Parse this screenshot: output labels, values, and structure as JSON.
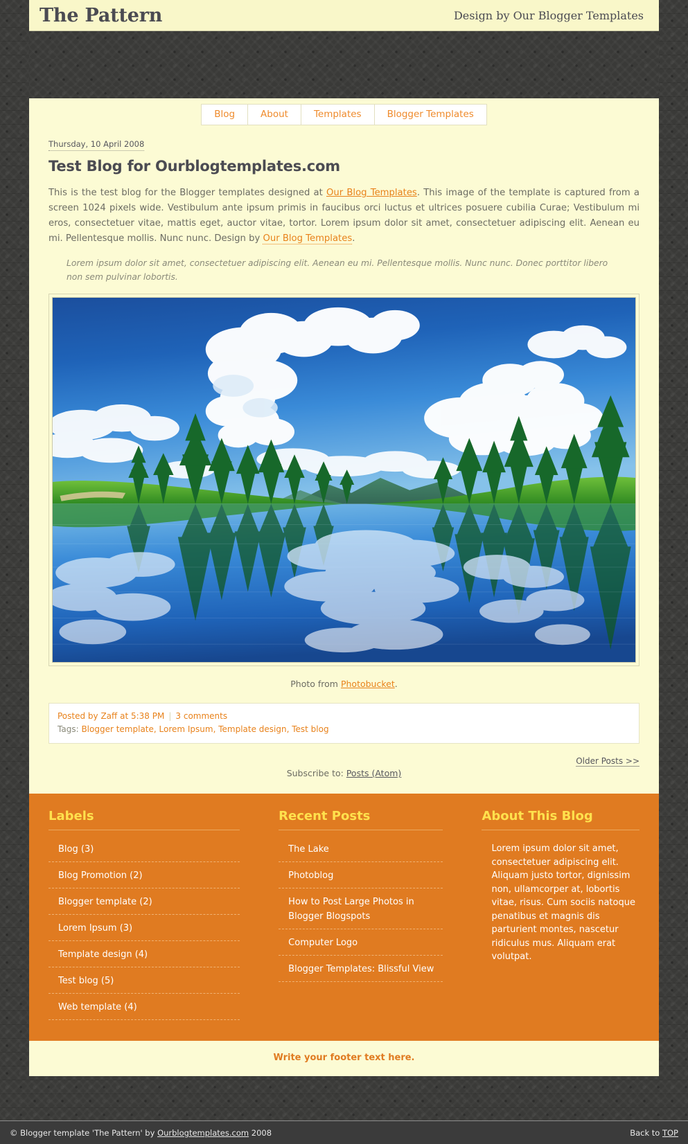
{
  "header": {
    "blog_title": "The Pattern",
    "designer_credit": "Design by Our Blogger Templates"
  },
  "nav": {
    "items": [
      {
        "label": "Blog"
      },
      {
        "label": "About"
      },
      {
        "label": "Templates"
      },
      {
        "label": "Blogger Templates"
      }
    ]
  },
  "post": {
    "date": "Thursday, 10 April 2008",
    "title": "Test Blog for Ourblogtemplates.com",
    "body_part1": "This is the test blog for the Blogger templates designed at ",
    "link1": "Our Blog Templates",
    "body_part2": ". This image of the template is captured from a screen 1024 pixels wide. Vestibulum ante ipsum primis in faucibus orci luctus et ultrices posuere cubilia Curae; Vestibulum mi eros, consectetuer vitae, mattis eget, auctor vitae, tortor. Lorem ipsum dolor sit amet, consectetuer adipiscing elit. Aenean eu mi. Pellentesque mollis. Nunc nunc. Design by ",
    "link2": "Our Blog Templates",
    "body_part3": ".",
    "quote": "Lorem ipsum dolor sit amet, consectetuer adipiscing elit. Aenean eu mi. Pellentesque mollis. Nunc nunc. Donec porttitor libero non sem pulvinar lobortis.",
    "photo_caption_prefix": "Photo from ",
    "photo_caption_link": "Photobucket",
    "photo_caption_suffix": ".",
    "posted_by": "Posted by Zaff at 5:38 PM",
    "comments": "3 comments",
    "tags_label": "Tags: ",
    "tags": "Blogger template, Lorem Ipsum, Template design, Test blog"
  },
  "pagination": {
    "older_posts": "Older Posts >>",
    "subscribe_label": "Subscribe to: ",
    "subscribe_link": "Posts (Atom)"
  },
  "columns": {
    "labels": {
      "heading": "Labels",
      "items": [
        {
          "label": "Blog (3)"
        },
        {
          "label": "Blog Promotion (2)"
        },
        {
          "label": "Blogger template (2)"
        },
        {
          "label": "Lorem Ipsum (3)"
        },
        {
          "label": "Template design (4)"
        },
        {
          "label": "Test blog (5)"
        },
        {
          "label": "Web template (4)"
        }
      ]
    },
    "recent_posts": {
      "heading": "Recent Posts",
      "items": [
        {
          "label": "The Lake"
        },
        {
          "label": "Photoblog"
        },
        {
          "label": "How to Post Large Photos in Blogger Blogspots"
        },
        {
          "label": "Computer Logo"
        },
        {
          "label": "Blogger Templates: Blissful View"
        }
      ]
    },
    "about": {
      "heading": "About This Blog",
      "text": "Lorem ipsum dolor sit amet, consectetuer adipiscing elit. Aliquam justo tortor, dignissim non, ullamcorper at, lobortis vitae, risus. Cum sociis natoque penatibus et magnis dis parturient montes, nascetur ridiculus mus. Aliquam erat volutpat."
    }
  },
  "footer": {
    "text": "Write your footer text here."
  },
  "credit": {
    "prefix": "© Blogger template 'The Pattern' by ",
    "link": "Ourblogtemplates.com",
    "suffix": " 2008",
    "back_prefix": "Back to ",
    "back_link": "TOP"
  },
  "colors": {
    "accent_orange": "#e07b21",
    "link_orange": "#e8821b",
    "cream": "#fcfbd4",
    "heading_yellow": "#ffe14d",
    "dark": "#3a3a38"
  }
}
